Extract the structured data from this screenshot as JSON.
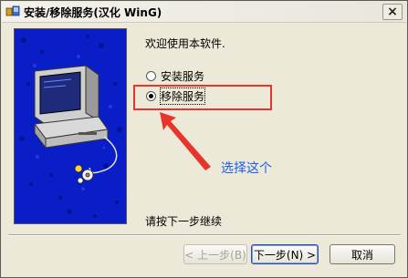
{
  "window": {
    "title": "安装/移除服务(汉化 WinG)",
    "close_symbol": "×"
  },
  "content": {
    "welcome": "欢迎使用本软件.",
    "options": [
      {
        "label": "安装服务",
        "checked": false
      },
      {
        "label": "移除服务",
        "checked": true
      }
    ],
    "next_hint": "请按下一步继续"
  },
  "annotation": {
    "text": "选择这个",
    "box_color": "#e8342a",
    "text_color": "#1e5ee8"
  },
  "buttons": {
    "back": "< 上一步(B)",
    "next": "下一步(N) >",
    "cancel": "取消"
  },
  "icons": {
    "app": "app-icon",
    "illustration": "computer-illustration"
  }
}
